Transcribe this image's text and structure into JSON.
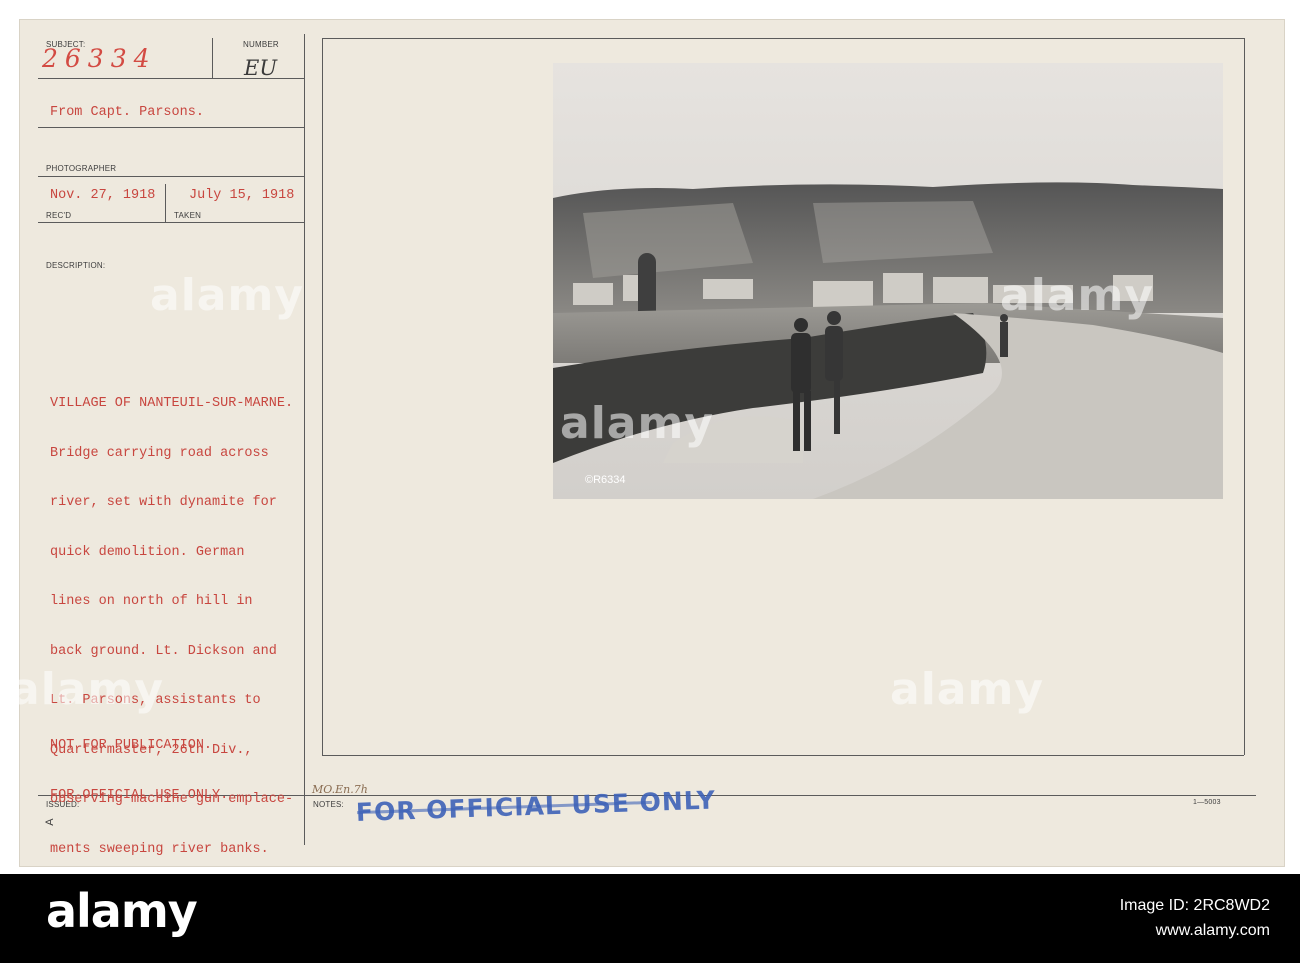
{
  "form": {
    "labels": {
      "subject": "SUBJECT:",
      "number": "NUMBER",
      "photographer": "PHOTOGRAPHER",
      "recd": "REC'D",
      "taken": "TAKEN",
      "description": "DESCRIPTION:",
      "issued": "ISSUED:",
      "notes": "NOTES:"
    },
    "subject_number": "26334",
    "number_value": "EU",
    "from": "From Capt. Parsons.",
    "date_received": "Nov. 27, 1918",
    "date_taken": "July 15, 1918",
    "description_lines": [
      "VILLAGE OF NANTEUIL-SUR-MARNE.",
      "Bridge carrying road across",
      "river, set with dynamite for",
      "quick demolition. German",
      "lines on north of hill in",
      "back ground. Lt. Dickson and",
      "Lt. Parsons, assistants to",
      "Quartermaster, 26th Div.,",
      "observing machine gun emplace-",
      "ments sweeping river banks."
    ],
    "restriction_lines": [
      "NOT FOR PUBLICATION.",
      "FOR OFFICIAL USE ONLY."
    ],
    "issued_mark": "A",
    "notes_handwritten": "MO.En.7h",
    "stamp": "FOR OFFICIAL USE ONLY",
    "form_number": "1—5003",
    "photo_negative_number": "©R6334"
  },
  "watermark": "alamy",
  "footer": {
    "logo": "alamy",
    "image_id_label": "Image ID: 2RC8WD2",
    "site": "www.alamy.com"
  },
  "colors": {
    "card": "#eee9de",
    "typewriter_red": "#c8463f",
    "stamp_blue": "#3e62b8",
    "footer": "#000000"
  }
}
